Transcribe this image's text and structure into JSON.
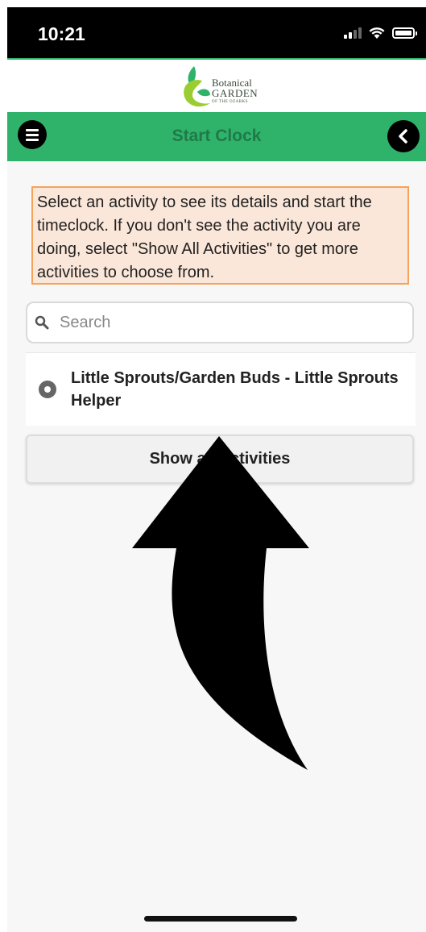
{
  "status_bar": {
    "time": "10:21"
  },
  "logo": {
    "line1": "Botanical",
    "line2": "GARDEN",
    "line3": "OF THE OZARKS",
    "icon": "botanical-garden-logo"
  },
  "nav": {
    "title": "Start Clock",
    "menu_icon": "hamburger-menu-icon",
    "back_icon": "chevron-left-icon"
  },
  "info_box": {
    "text": "Select an activity to see its details and start the timeclock. If you don't see the activity you are doing, select \"Show All Activities\" to get more activities to choose from."
  },
  "search": {
    "placeholder": "Search",
    "value": ""
  },
  "activities": [
    {
      "label": "Little Sprouts/Garden Buds - Little Sprouts Helper",
      "selected": false
    }
  ],
  "show_all_button": {
    "label": "Show all Activities"
  },
  "colors": {
    "nav_green": "#2fb36b",
    "nav_title": "#1f7a47",
    "info_bg": "#fbe7d9",
    "info_border": "#f5a35b"
  }
}
